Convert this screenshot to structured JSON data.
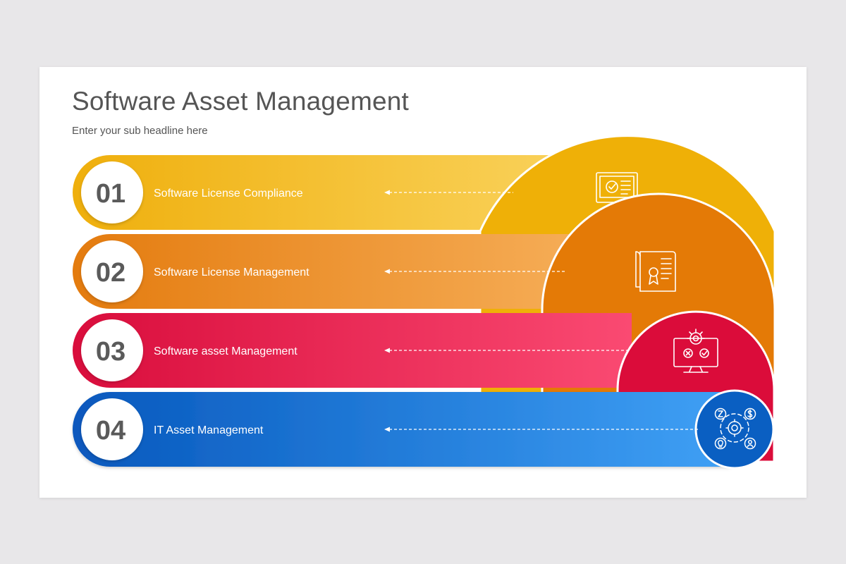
{
  "header": {
    "title": "Software Asset Management",
    "subtitle": "Enter your sub headline here"
  },
  "steps": [
    {
      "number": "01",
      "label": "Software License Compliance",
      "icon": "monitor-check-icon",
      "color": "#F0B20A"
    },
    {
      "number": "02",
      "label": "Software License Management",
      "icon": "certificate-document-icon",
      "color": "#E57C0B"
    },
    {
      "number": "03",
      "label": "Software asset Management",
      "icon": "monitor-gear-icon",
      "color": "#DC0F3E"
    },
    {
      "number": "04",
      "label": "IT Asset Management",
      "icon": "asset-network-icon",
      "color": "#0A62C4"
    }
  ]
}
